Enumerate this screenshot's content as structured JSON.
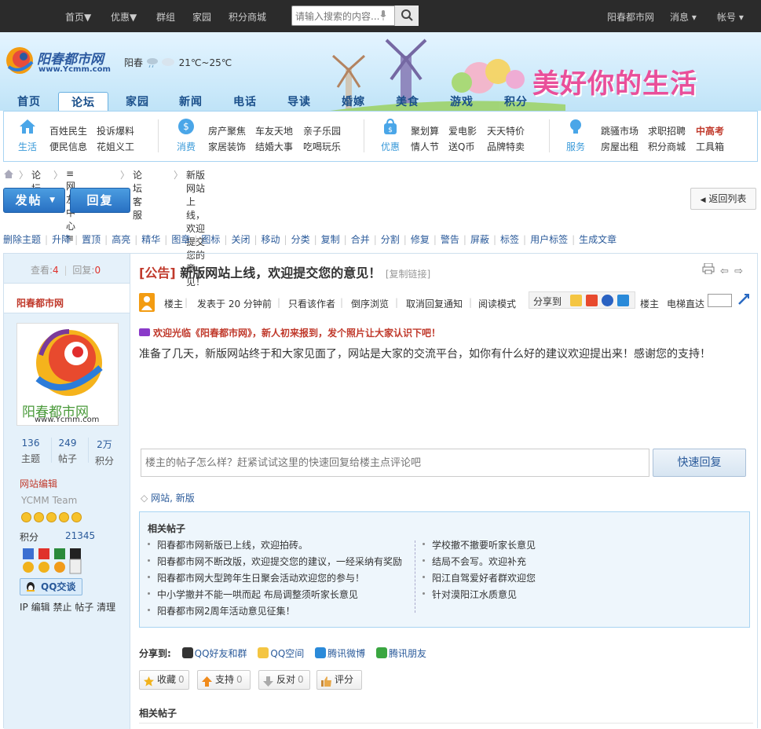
{
  "topbar": {
    "nav": [
      "首页▼",
      "优惠▼",
      "群组",
      "家园",
      "积分商城"
    ],
    "search_placeholder": "请输入搜索的内容...",
    "right": [
      "阳春都市网",
      "消息 ▾",
      "帐号 ▾"
    ]
  },
  "header": {
    "logo_text": "阳春都市网",
    "logo_url_text": "www.Ycmm.com",
    "city": "阳春",
    "temperature": "21℃~25℃",
    "banner_slogan": "美好你的生活"
  },
  "mainnav": {
    "items": [
      "首页",
      "论坛",
      "家园",
      "新闻",
      "电话",
      "导读",
      "婚嫁",
      "美食",
      "游戏",
      "积分"
    ],
    "active_index": 1
  },
  "subnav": {
    "groups": [
      {
        "icon": "house-icon",
        "label": "生活",
        "links": [
          "百姓民生",
          "投诉爆料",
          "便民信息",
          "花姐义工"
        ]
      },
      {
        "icon": "coin-icon",
        "label": "消费",
        "links": [
          "房产聚焦",
          "车友天地",
          "亲子乐园",
          "家居装饰",
          "结婚大事",
          "吃喝玩乐"
        ]
      },
      {
        "icon": "bag-icon",
        "label": "优惠",
        "links": [
          "聚划算",
          "爱电影",
          "天天特价",
          "情人节",
          "送Q币",
          "品牌特卖"
        ]
      },
      {
        "icon": "bulb-icon",
        "label": "服务",
        "links": [
          "跳骚市场",
          "求职招聘",
          "中高考",
          "房屋出租",
          "积分商城",
          "工具箱"
        ]
      }
    ],
    "highlight_color": "#c0392b"
  },
  "breadcrumb": [
    "论坛",
    "≡网友中心≡",
    "论坛客服",
    "新版网站上线，欢迎提交您的意见！"
  ],
  "buttons": {
    "post": "发帖",
    "reply": "回复",
    "back_list": "返回列表"
  },
  "admin_actions": [
    "删除主题",
    "升降",
    "置顶",
    "高亮",
    "精华",
    "图章",
    "图标",
    "关闭",
    "移动",
    "分类",
    "复制",
    "合并",
    "分割",
    "修复",
    "警告",
    "屏蔽",
    "标签",
    "用户标签",
    "生成文章"
  ],
  "left": {
    "views_label": "查看:",
    "views": "4",
    "replies_label": "回复:",
    "replies": "0",
    "username": "阳春都市网",
    "avatar_text": "阳春都市网",
    "avatar_url_text": "www.Ycmm.com",
    "stats": [
      {
        "value": "136",
        "label": "主题"
      },
      {
        "value": "249",
        "label": "帖子"
      },
      {
        "value": "2万",
        "label": "积分"
      }
    ],
    "group": "网站编辑",
    "team": "YCMM Team",
    "score_label": "积分",
    "score": "21345",
    "qq_button": "QQ交谈",
    "tools": [
      "IP",
      "编辑",
      "禁止",
      "帖子",
      "清理"
    ]
  },
  "post": {
    "tag": "[公告]",
    "title": "新版网站上线，欢迎提交您的意见！",
    "copy_link": "[复制链接]",
    "author_label": "楼主",
    "posted": "发表于 20 分钟前",
    "only_author": "只看该作者",
    "reverse": "倒序浏览",
    "cancel_notify": "取消回复通知",
    "read_mode": "阅读模式",
    "share_label": "分享到",
    "floor": "楼主",
    "elevator": "电梯直达",
    "welcome": "欢迎光临《阳春都市网》，新人初来报到，发个照片让大家认识下吧！",
    "body": "准备了几天，新版网站终于和大家见面了，网站是大家的交流平台，如你有什么好的建议欢迎提出来！感谢您的支持！",
    "reply_placeholder": "楼主的帖子怎么样？赶紧试试这里的快速回复给楼主点评论吧",
    "quick_reply": "快速回复",
    "tags": "网站, 新版"
  },
  "related": {
    "heading": "相关帖子",
    "left": [
      "阳春都市网新版已上线，欢迎拍砖。",
      "阳春都市网不断改版，欢迎提交您的建议，一经采纳有奖励",
      "阳春都市网大型跨年生日聚会活动欢迎您的参与！",
      "中小学撤并不能一哄而起 布局调整须听家长意见",
      "阳春都市网2周年活动意见征集！"
    ],
    "right": [
      "学校撤不撤要听家长意见",
      "结局不会写。欢迎补充",
      "阳江自驾爱好者群欢迎您",
      "针对漠阳江水质意见"
    ]
  },
  "share": {
    "label": "分享到:",
    "items": [
      "QQ好友和群",
      "QQ空间",
      "腾讯微博",
      "腾讯朋友"
    ]
  },
  "actions": [
    {
      "label": "收藏",
      "count": "0"
    },
    {
      "label": "支持",
      "count": "0"
    },
    {
      "label": "反对",
      "count": "0"
    },
    {
      "label": "评分",
      "count": ""
    }
  ],
  "related2_heading": "相关帖子"
}
